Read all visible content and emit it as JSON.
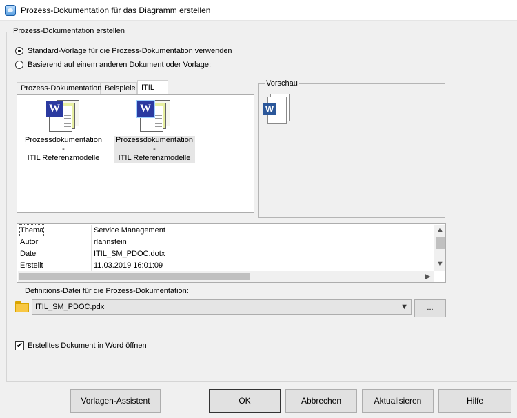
{
  "window": {
    "title": "Prozess-Dokumentation für das Diagramm erstellen"
  },
  "group": {
    "label": "Prozess-Dokumentation erstellen"
  },
  "options": {
    "standard": "Standard-Vorlage für die Prozess-Dokumentation verwenden",
    "based_on": "Basierend auf einem anderen Dokument oder Vorlage:"
  },
  "tabs": [
    "Prozess-Dokumentation",
    "Beispiele",
    "ITIL"
  ],
  "templates": [
    {
      "line1": "Prozessdokumentation -",
      "line2": "ITIL Referenzmodelle"
    },
    {
      "line1": "Prozessdokumentation -",
      "line2": "ITIL Referenzmodelle"
    }
  ],
  "preview": {
    "label": "Vorschau"
  },
  "properties": [
    {
      "key": "Thema",
      "value": "Service Management"
    },
    {
      "key": "Autor",
      "value": "rlahnstein"
    },
    {
      "key": "Datei",
      "value": "ITIL_SM_PDOC.dotx"
    },
    {
      "key": "Erstellt",
      "value": "11.03.2019 16:01:09"
    }
  ],
  "definition": {
    "label": "Definitions-Datei für die Prozess-Dokumentation:",
    "file": "ITIL_SM_PDOC.pdx",
    "browse": "..."
  },
  "open_in_word": {
    "label": "Erstelltes Dokument in Word öffnen",
    "checked": true,
    "mark": "✔"
  },
  "buttons": {
    "wizard": "Vorlagen-Assistent",
    "ok": "OK",
    "cancel": "Abbrechen",
    "refresh": "Aktualisieren",
    "help": "Hilfe"
  },
  "icons": {
    "app": "app-icon",
    "word_letter": "W",
    "scroll_up": "▲",
    "scroll_down": "▼",
    "scroll_left": "◀",
    "scroll_right": "▶",
    "combo_arrow": "▼"
  }
}
